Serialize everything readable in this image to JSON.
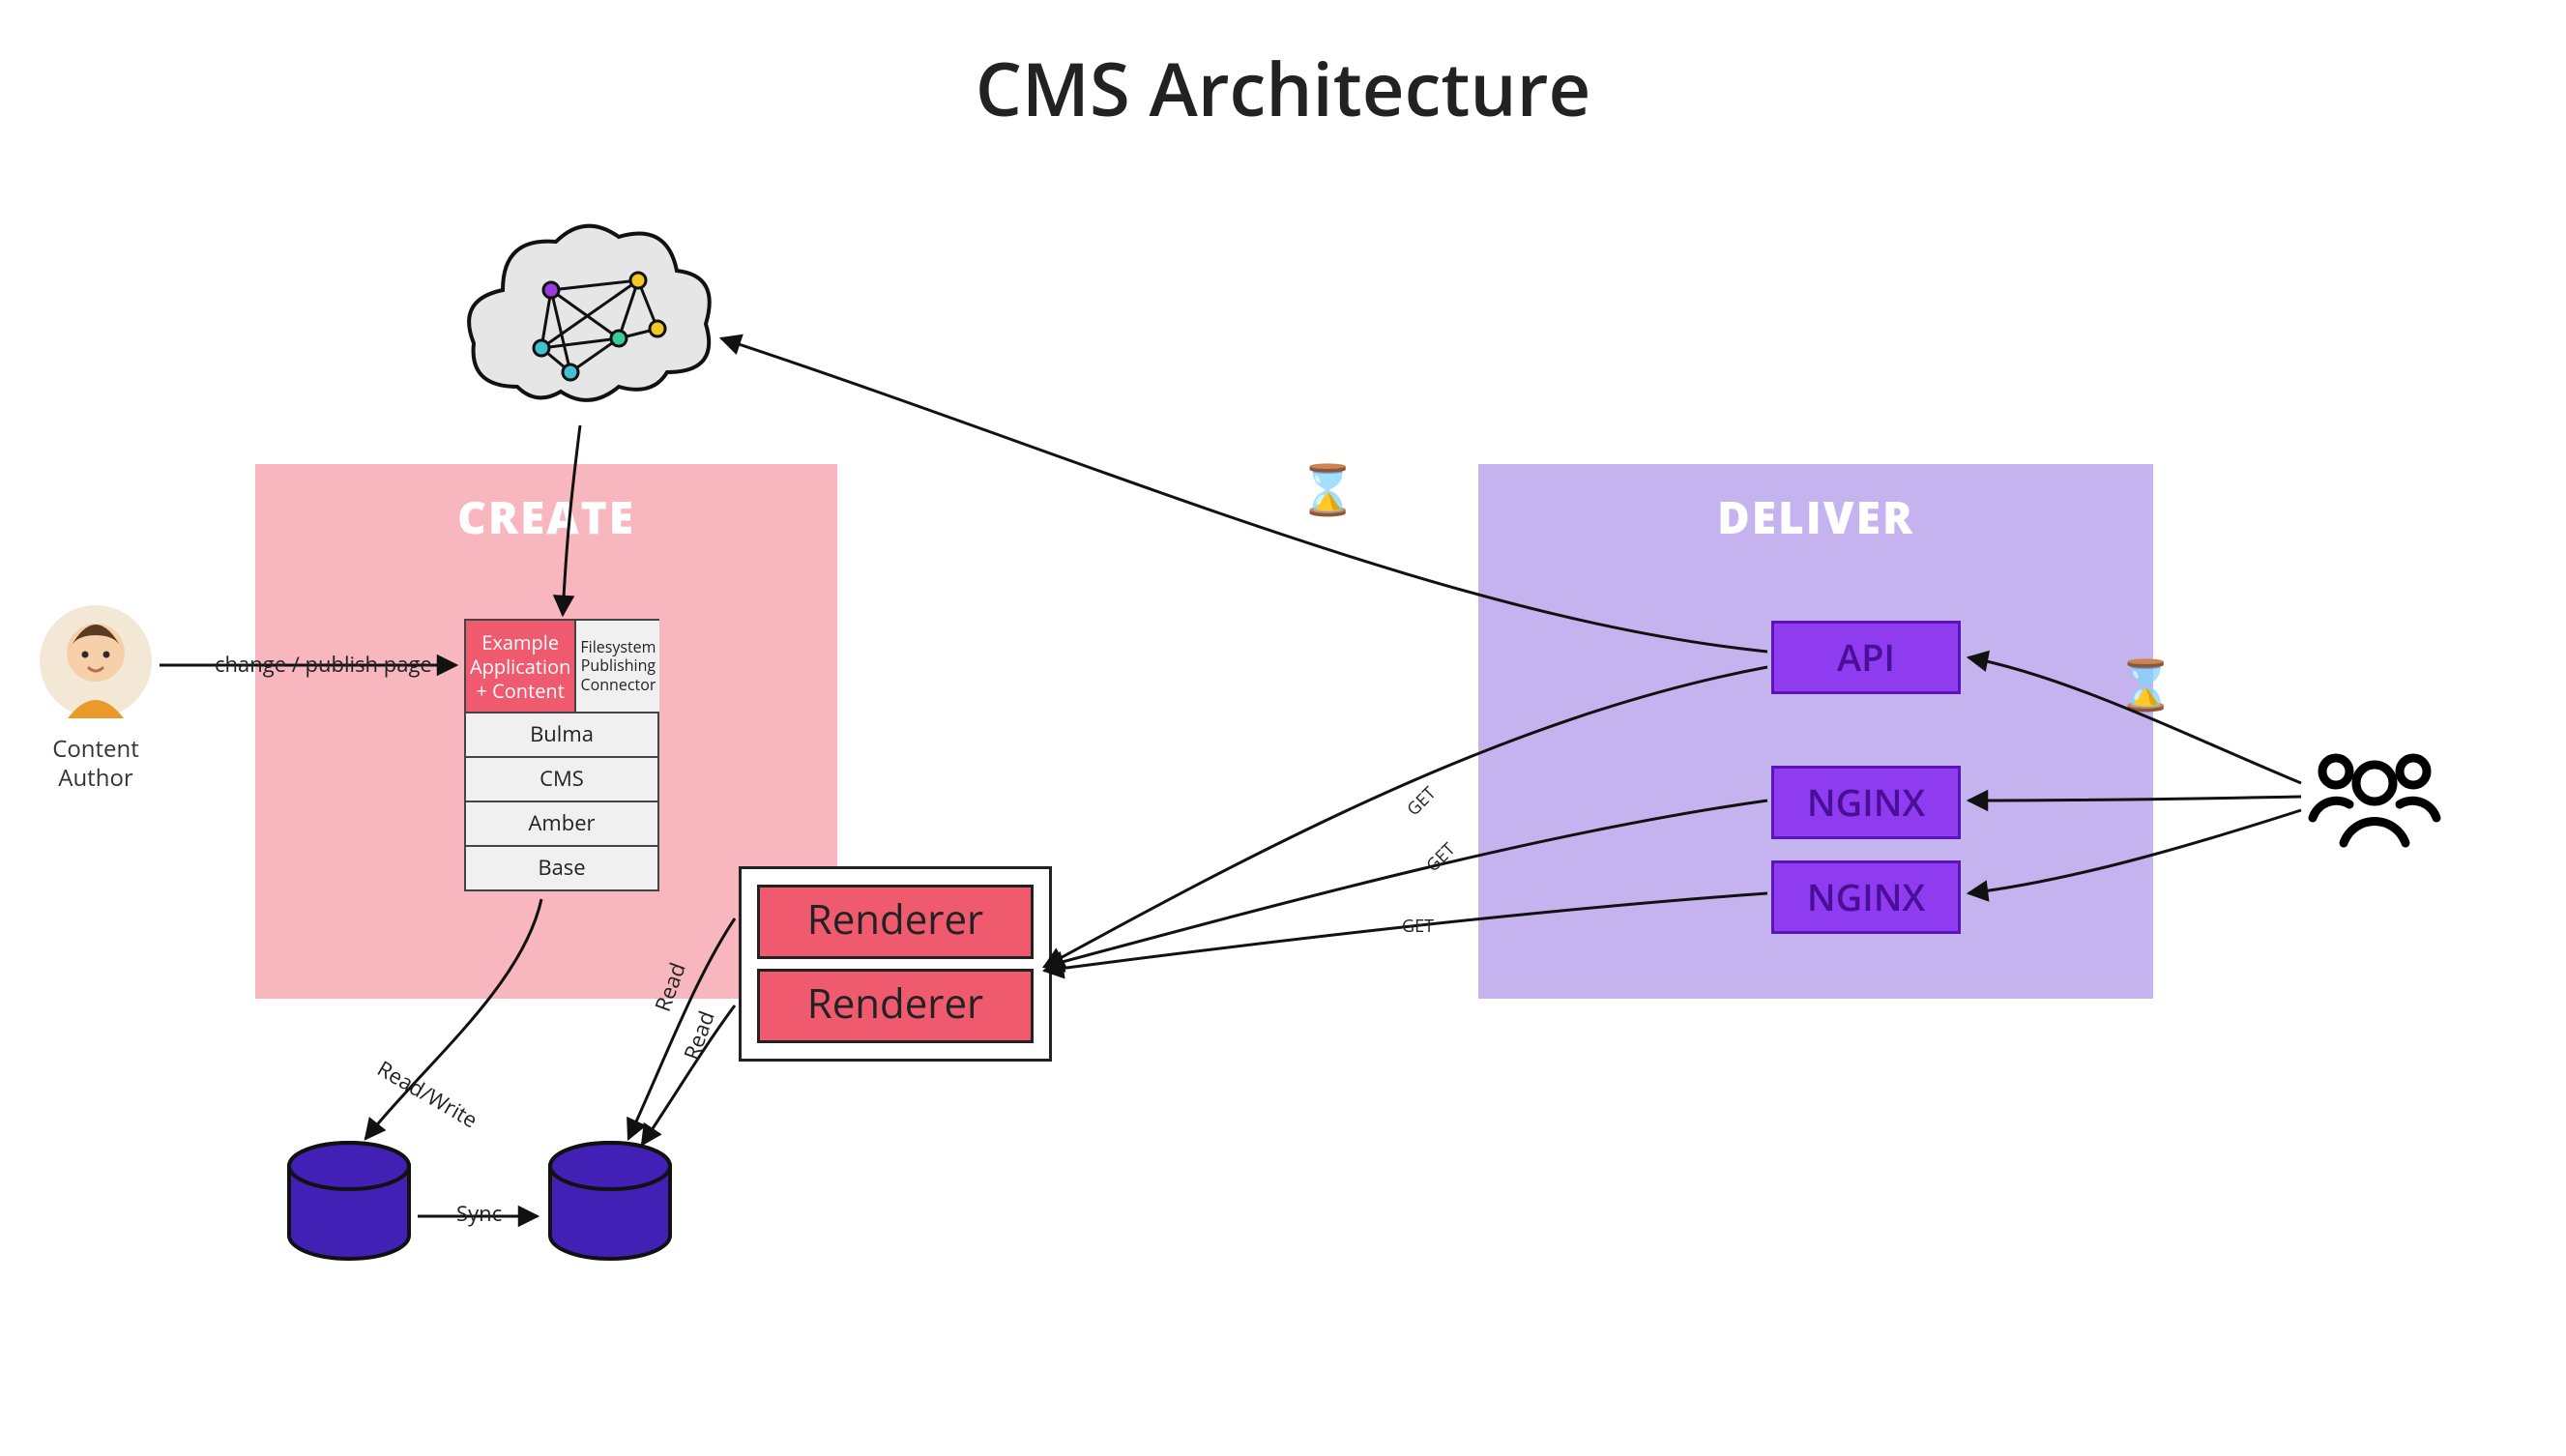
{
  "title": "CMS Architecture",
  "panels": {
    "create": "CREATE",
    "deliver": "DELIVER"
  },
  "author_label_line1": "Content",
  "author_label_line2": "Author",
  "edge_labels": {
    "change_publish": "change / publish page",
    "read_write": "Read/Write",
    "read1": "Read",
    "read2": "Read",
    "sync": "Sync",
    "get1": "GET",
    "get2": "GET",
    "get3": "GET"
  },
  "stack": {
    "top_left": "Example\nApplication\n+ Content",
    "top_right": "Filesystem\nPublishing\nConnector",
    "rows": [
      "Bulma",
      "CMS",
      "Amber",
      "Base"
    ]
  },
  "renderer": {
    "label": "Renderer",
    "count": 2
  },
  "deliver_boxes": {
    "api": "API",
    "nginx1": "NGINX",
    "nginx2": "NGINX"
  },
  "icons": {
    "author": "author-avatar-icon",
    "cloud_network": "cloud-network-icon",
    "hourglass": "hourglass-icon",
    "users": "users-group-icon",
    "database": "database-icon"
  },
  "colors": {
    "create_panel": "#f8b7bf",
    "deliver_panel": "#c5b3f0",
    "accent_red": "#ef5a6f",
    "accent_purple": "#8f3cf0",
    "db_fill": "#4120b6"
  }
}
